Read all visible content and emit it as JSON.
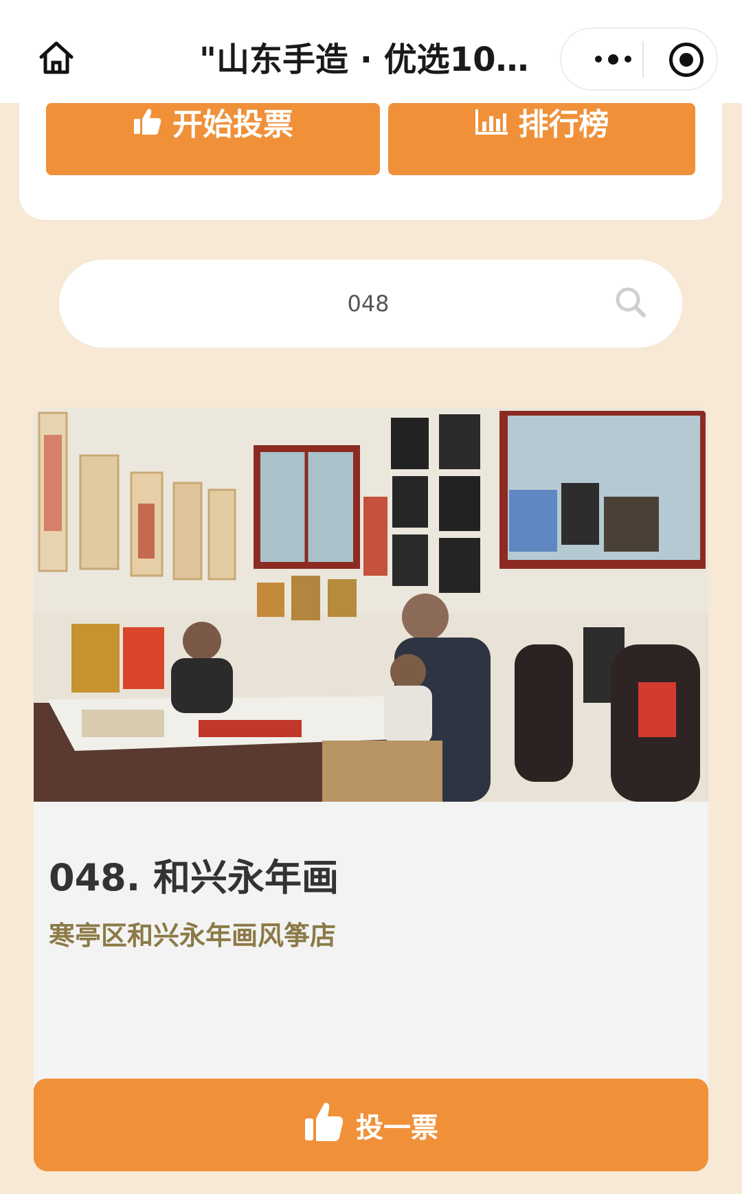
{
  "navbar": {
    "title": "\"山东手造 · 优选10…",
    "home_icon": "home-icon",
    "more_icon": "more-dots-icon",
    "target_icon": "record-circle-icon"
  },
  "actions": {
    "start_vote_label": "开始投票",
    "ranking_label": "排行榜"
  },
  "search": {
    "value": "048",
    "icon": "search-icon"
  },
  "result": {
    "title": "048. 和兴永年画",
    "subtitle": "寒亭区和兴永年画风筝店",
    "vote_label": "投一票"
  },
  "colors": {
    "accent": "#f0913a",
    "background": "#f7e9d5",
    "subtitle": "#8b7a46"
  }
}
